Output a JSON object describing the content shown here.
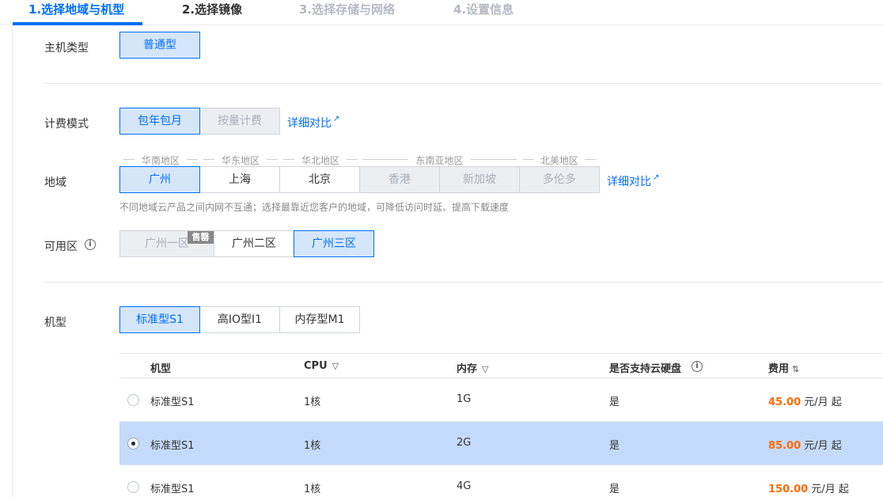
{
  "steps": [
    {
      "label": "1.选择地域与机型"
    },
    {
      "label": "2.选择镜像"
    },
    {
      "label": "3.选择存储与网络"
    },
    {
      "label": "4.设置信息"
    }
  ],
  "host_type": {
    "label": "主机类型",
    "options": [
      "普通型"
    ]
  },
  "billing": {
    "label": "计费模式",
    "options": [
      "包年包月",
      "按量计费"
    ],
    "compare_link": "详细对比"
  },
  "region": {
    "label": "地域",
    "groups": [
      "华南地区",
      "华东地区",
      "华北地区",
      "东南亚地区",
      "北美地区"
    ],
    "options": [
      "广州",
      "上海",
      "北京",
      "香港",
      "新加坡",
      "多伦多"
    ],
    "compare_link": "详细对比",
    "hint": "不同地域云产品之间内网不互通；选择最靠近您客户的地域，可降低访问时延、提高下载速度"
  },
  "zone": {
    "label": "可用区",
    "options": [
      "广州一区",
      "广州二区",
      "广州三区"
    ],
    "soldout_badge": "售罄"
  },
  "model": {
    "label": "机型",
    "options": [
      "标准型S1",
      "高IO型I1",
      "内存型M1"
    ]
  },
  "table": {
    "headers": {
      "model": "机型",
      "cpu": "CPU",
      "memory": "内存",
      "cloud_disk": "是否支持云硬盘",
      "fee": "费用"
    },
    "rows": [
      {
        "model": "标准型S1",
        "cpu": "1核",
        "memory": "1G",
        "cloud_disk": "是",
        "price": "45.00",
        "unit": "元/月 起"
      },
      {
        "model": "标准型S1",
        "cpu": "1核",
        "memory": "2G",
        "cloud_disk": "是",
        "price": "85.00",
        "unit": "元/月 起"
      },
      {
        "model": "标准型S1",
        "cpu": "1核",
        "memory": "4G",
        "cloud_disk": "是",
        "price": "150.00",
        "unit": "元/月 起"
      }
    ]
  },
  "colors": {
    "accent": "#006eff",
    "selected_row": "#c4dafa",
    "price": "#ff6a00"
  }
}
